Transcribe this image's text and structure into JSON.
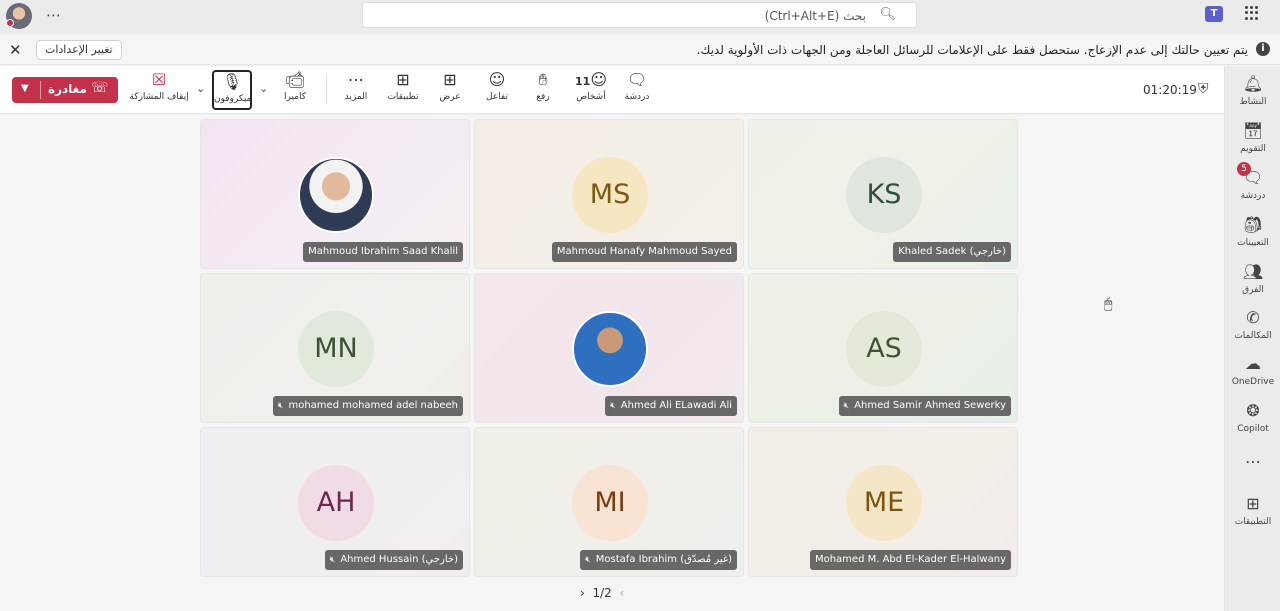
{
  "topbar": {
    "search_placeholder": "بحث (Ctrl+Alt+E)",
    "more_icon": "⋯",
    "teams_logo_text": "T"
  },
  "banner": {
    "settings_button": "تغيير الإعدادات",
    "message": "يتم تعيين حالتك إلى عدم الإزعاج. ستحصل فقط على الإعلامات للرسائل العاجلة ومن الجهات ذات الأولوية لديك.",
    "close_icon": "✕",
    "info_icon": "i"
  },
  "toolbar": {
    "leave_label": "مغادرة",
    "stop_sharing": "إيقاف المشاركة",
    "mic": "ميكروفون",
    "camera": "كاميرا",
    "more": "المزيد",
    "apps": "تطبيقات",
    "view": "عرض",
    "react": "تفاعل",
    "raise": "رفع",
    "people": "أشخاص",
    "people_count": "11",
    "chat": "دردشة",
    "timer": "01:20:19"
  },
  "participants": [
    {
      "name": "Mahmoud Ibrahim Saad Khalil",
      "initials": "",
      "photo": true,
      "muted": false
    },
    {
      "name": "Mahmoud Hanafy Mahmoud Sayed",
      "initials": "MS",
      "photo": false,
      "muted": false
    },
    {
      "name": "Khaled Sadek (خارجي)",
      "initials": "KS",
      "photo": false,
      "muted": false
    },
    {
      "name": "mohamed mohamed adel nabeeh",
      "initials": "MN",
      "photo": false,
      "muted": true
    },
    {
      "name": "Ahmed Ali ELawadi Ali",
      "initials": "",
      "photo": true,
      "muted": true
    },
    {
      "name": "Ahmed Samir Ahmed Sewerky",
      "initials": "AS",
      "photo": false,
      "muted": true
    },
    {
      "name": "Ahmed Hussain (خارجي)",
      "initials": "AH",
      "photo": false,
      "muted": true
    },
    {
      "name": "Mostafa Ibrahim (غير مُصدّق)",
      "initials": "MI",
      "photo": false,
      "muted": true
    },
    {
      "name": "Mohamed M. Abd El-Kader El-Halwany",
      "initials": "ME",
      "photo": false,
      "muted": false
    }
  ],
  "pager": {
    "current": "1/2",
    "next_icon": "›",
    "prev_icon": "‹"
  },
  "rail": {
    "activity": "النشاط",
    "calendar": "التقويم",
    "chat": "دردشة",
    "chat_badge": "5",
    "assignments": "التعيينات",
    "teams": "الفرق",
    "calls": "المكالمات",
    "onedrive": "OneDrive",
    "copilot": "Copilot",
    "more_icon": "⋯",
    "apps": "التطبيقات"
  },
  "colors": {
    "leave": "#c4314b",
    "accent": "#5b5fc7"
  }
}
